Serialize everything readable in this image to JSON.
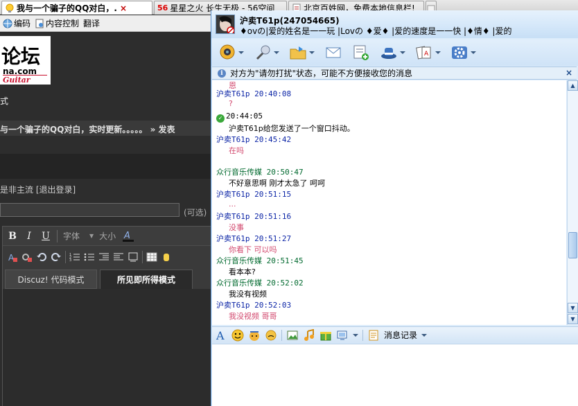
{
  "browser": {
    "tabs": [
      {
        "label": "我与一个骗子的QQ对白，.",
        "close": "×",
        "active": true
      },
      {
        "label": "星星之火 长生无极 - 56空间",
        "active": false
      },
      {
        "label": "北京百姓网，免费本地信息栏!",
        "active": false
      }
    ],
    "tab2_favicon_text": "56",
    "toolbar": {
      "encoding": "编码",
      "content_control": "内容控制",
      "translate": "翻译"
    }
  },
  "page": {
    "logo_title": "论坛",
    "logo_domain": "na.com",
    "logo_guitar": "Guitar",
    "mode_label": "式",
    "topic_line": "与一个骗子的QQ对白，实时更新。。。。。 » 发表",
    "user_line": "是非主流 [退出登录]",
    "optional_label": "(可选)",
    "editor": {
      "bold": "B",
      "italic": "I",
      "underline": "U",
      "font_select": "字体",
      "size_select": "大小",
      "tab_code": "Discuz! 代码模式",
      "tab_wysiwyg": "所见即所得模式"
    }
  },
  "qq": {
    "contact_name": "沪卖T61p(247054665)",
    "signature": "♦ovの|爱的姓名是一一玩 |Lovの ♦爱♦ |爱的速度是一一快 |♦情♦ |爱的",
    "notice": "对方为\"请勿打扰\"状态，可能不方便接收您的消息",
    "notice_close": "×",
    "messages": [
      {
        "kind": "them-body",
        "text": "恩"
      },
      {
        "kind": "them-head",
        "text": "沪卖T61p  20:40:08"
      },
      {
        "kind": "them-body",
        "text": "?"
      },
      {
        "kind": "sys-head",
        "text": "20:44:05"
      },
      {
        "kind": "sys-body",
        "text": "沪卖T61p给您发送了一个窗口抖动。"
      },
      {
        "kind": "them-head",
        "text": "沪卖T61p  20:45:42"
      },
      {
        "kind": "them-body",
        "text": "在吗"
      },
      {
        "kind": "me-head",
        "text": "众行音乐传媒  20:50:47"
      },
      {
        "kind": "me-body",
        "text": "不好意思啊   刚才太急了   呵呵"
      },
      {
        "kind": "them-head",
        "text": "沪卖T61p  20:51:15"
      },
      {
        "kind": "them-body",
        "text": "..."
      },
      {
        "kind": "them-head",
        "text": "沪卖T61p  20:51:16"
      },
      {
        "kind": "them-body",
        "text": "没事"
      },
      {
        "kind": "them-head",
        "text": "沪卖T61p  20:51:27"
      },
      {
        "kind": "them-body",
        "text": "你看下  可以吗"
      },
      {
        "kind": "me-head",
        "text": "众行音乐传媒  20:51:45"
      },
      {
        "kind": "me-body",
        "text": "看本本?"
      },
      {
        "kind": "me-head",
        "text": "众行音乐传媒  20:52:02"
      },
      {
        "kind": "me-body",
        "text": "我没有视频"
      },
      {
        "kind": "them-head",
        "text": "沪卖T61p  20:52:03"
      },
      {
        "kind": "them-body",
        "text": "我没视频  哥哥"
      }
    ],
    "input_toolbar": {
      "history_label": "消息记录"
    },
    "colors": {
      "them": "#0b24a6",
      "me": "#00692e",
      "them_text": "#d2486e"
    }
  }
}
